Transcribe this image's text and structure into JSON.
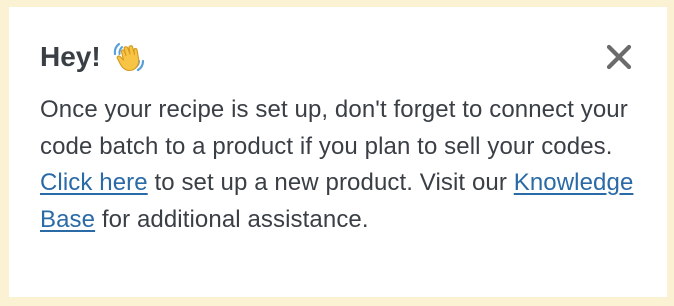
{
  "notice": {
    "title": "Hey!",
    "wave_icon": "waving-hand-icon",
    "close_icon": "close-icon",
    "body": {
      "part1": "Once your recipe is set up, don't forget to connect your code batch to a product if you plan to sell your codes. ",
      "link1": "Click here",
      "part2": " to set up a new product. Visit our ",
      "link2": "Knowledge Base",
      "part3": " for additional assistance."
    }
  },
  "colors": {
    "page_background": "#fbf1d3",
    "panel_background": "#ffffff",
    "text": "#3a3f45",
    "link": "#2a6aa6",
    "close_icon": "#6b6b6b"
  }
}
